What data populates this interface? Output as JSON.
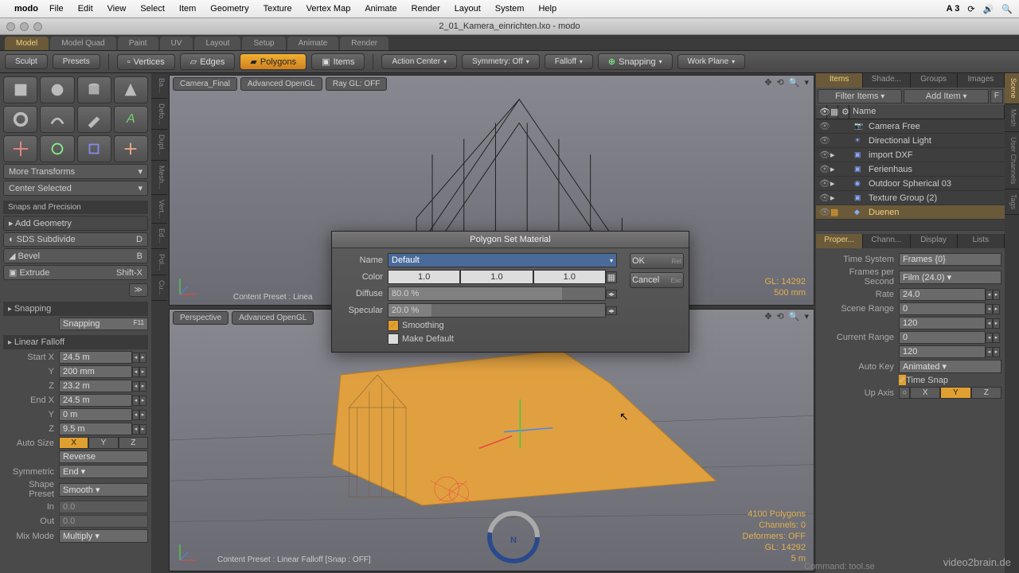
{
  "menubar": {
    "app": "modo",
    "items": [
      "File",
      "Edit",
      "View",
      "Select",
      "Item",
      "Geometry",
      "Texture",
      "Vertex Map",
      "Animate",
      "Render",
      "Layout",
      "System",
      "Help"
    ],
    "right_badge": "A 3"
  },
  "window_title": "2_01_Kamera_einrichten.lxo - modo",
  "layout_tabs": [
    "Model",
    "Model Quad",
    "Paint",
    "UV",
    "Layout",
    "Setup",
    "Animate",
    "Render"
  ],
  "layout_tab_active": 0,
  "toolbar_left": {
    "sculpt": "Sculpt",
    "presets": "Presets"
  },
  "sel_modes": [
    {
      "label": "Vertices",
      "active": false
    },
    {
      "label": "Edges",
      "active": false
    },
    {
      "label": "Polygons",
      "active": true
    },
    {
      "label": "Items",
      "active": false
    }
  ],
  "toolbar_drops": [
    "Action Center",
    "Symmetry: Off",
    "Falloff",
    "Snapping",
    "Work Plane"
  ],
  "left": {
    "more_transforms": "More Transforms",
    "center_selected": "Center Selected",
    "snaps_hdr": "Snaps and Precision",
    "add_geom": "Add Geometry",
    "ops": [
      {
        "label": "SDS Subdivide",
        "hk": "D"
      },
      {
        "label": "Bevel",
        "hk": "B"
      },
      {
        "label": "Extrude",
        "hk": "Shift-X"
      }
    ],
    "snapping_hdr": "Snapping",
    "snapping_btn": "Snapping",
    "snapping_hk": "F11",
    "falloff_hdr": "Linear Falloff",
    "start": {
      "x": "24.5 m",
      "y": "200 mm",
      "z": "23.2 m"
    },
    "end": {
      "x": "24.5 m",
      "y": "0 m",
      "z": "9.5 m"
    },
    "auto_size": "Auto Size",
    "reverse": "Reverse",
    "symmetric_lbl": "Symmetric",
    "symmetric": "End",
    "shape_lbl": "Shape Preset",
    "shape": "Smooth",
    "in_lbl": "In",
    "in_v": "0.0",
    "out_lbl": "Out",
    "out_v": "0.0",
    "mix_lbl": "Mix Mode",
    "mix": "Multiply",
    "vtabs": [
      "Ba...",
      "Defo...",
      "Dupl...",
      "Mesh...",
      "Vert...",
      "Ed...",
      "Pol...",
      "Cu..."
    ]
  },
  "vp1": {
    "hdr": [
      "Camera_Final",
      "Advanced OpenGL",
      "Ray GL: OFF"
    ],
    "status": "Content Preset : Linea",
    "stats": [
      "GL: 14292",
      "500 mm"
    ]
  },
  "vp2": {
    "hdr": [
      "Perspective",
      "Advanced OpenGL"
    ],
    "status": "Content Preset : Linear Falloff [Snap : OFF]",
    "stats": [
      "4100 Polygons",
      "Channels: 0",
      "Deformers: OFF",
      "GL: 14292",
      "5 m"
    ]
  },
  "dialog": {
    "title": "Polygon Set Material",
    "name_lbl": "Name",
    "name": "Default",
    "color_lbl": "Color",
    "r": "1.0",
    "g": "1.0",
    "b": "1.0",
    "diffuse_lbl": "Diffuse",
    "diffuse": "80.0 %",
    "specular_lbl": "Specular",
    "specular": "20.0 %",
    "smoothing": "Smoothing",
    "make_default": "Make Default",
    "ok": "OK",
    "ok_hk": "Ret",
    "cancel": "Cancel",
    "cancel_hk": "Esc"
  },
  "right": {
    "top_tabs": [
      "Items",
      "Shade...",
      "Groups",
      "Images"
    ],
    "top_active": 0,
    "filter": "Filter Items",
    "add": "Add Item",
    "name_hdr": "Name",
    "items": [
      {
        "name": "Camera Free",
        "indent": 0
      },
      {
        "name": "Directional Light",
        "indent": 0
      },
      {
        "name": "import DXF",
        "indent": 0,
        "arrow": true
      },
      {
        "name": "Ferienhaus",
        "indent": 0,
        "arrow": true
      },
      {
        "name": "Outdoor Spherical 03",
        "indent": 0,
        "arrow": true
      },
      {
        "name": "Texture Group (2)",
        "indent": 0,
        "arrow": true
      },
      {
        "name": "Duenen",
        "indent": 0,
        "sel": true
      }
    ],
    "prop_tabs": [
      "Proper...",
      "Chann...",
      "Display",
      "Lists"
    ],
    "prop_active": 0,
    "props": {
      "time_system_lbl": "Time System",
      "time_system": "Frames {0}",
      "fps_lbl": "Frames per Second",
      "fps": "Film (24.0)",
      "rate_lbl": "Rate",
      "rate": "24.0",
      "scene_range_lbl": "Scene Range",
      "scene_a": "0",
      "scene_b": "120",
      "current_range_lbl": "Current Range",
      "cur_a": "0",
      "cur_b": "120",
      "auto_key_lbl": "Auto Key",
      "auto_key": "Animated",
      "time_snap": "Time Snap",
      "up_axis_lbl": "Up Axis"
    },
    "vtabs": [
      "Scene",
      "Mesh",
      "User Channels",
      "Tags"
    ]
  },
  "command_lbl": "Command:",
  "command": "tool.se",
  "watermark": "video2brain.de"
}
